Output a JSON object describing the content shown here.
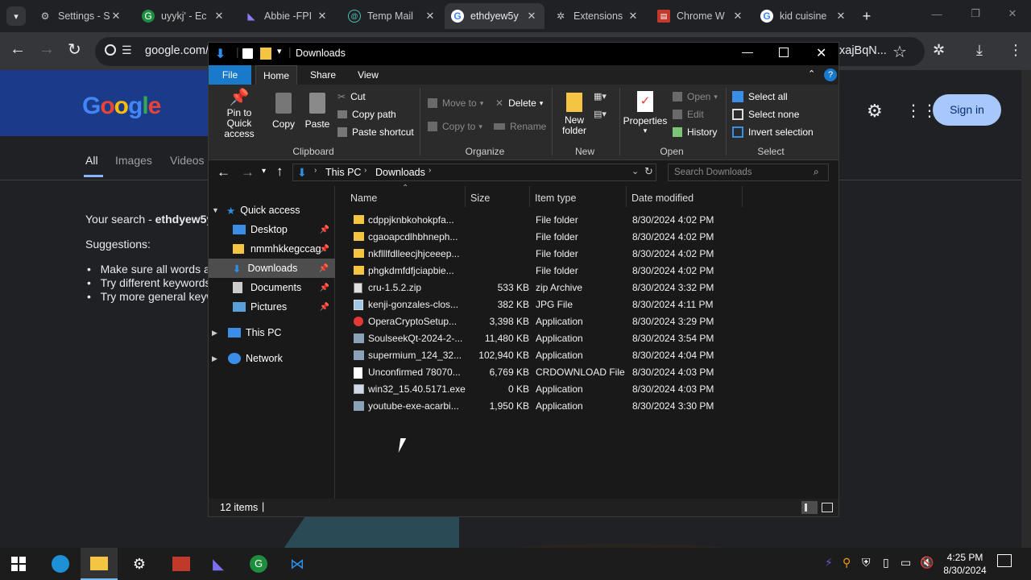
{
  "chrome": {
    "tabs": [
      {
        "title": "Settings - Se",
        "icon": "gear-icon"
      },
      {
        "title": "uyykj' - Ec",
        "icon": "green-logo-icon"
      },
      {
        "title": "Abbie -FPI",
        "icon": "proton-icon"
      },
      {
        "title": "Temp Mail",
        "icon": "tempmail-icon"
      },
      {
        "title": "ethdyew5y",
        "icon": "google-icon"
      },
      {
        "title": "Extensions",
        "icon": "puzzle-icon"
      },
      {
        "title": "Chrome W",
        "icon": "store-icon"
      },
      {
        "title": "kid cuisine",
        "icon": "google-icon"
      }
    ],
    "url": "google.com/",
    "url_right": "xajBqN..."
  },
  "google": {
    "tabs": [
      "All",
      "Images",
      "Videos"
    ],
    "search_prefix": "Your search - ",
    "search_term": "ethdyew5y",
    "suggestions_label": "Suggestions:",
    "suggestions": [
      "Make sure all words a",
      "Try different keywords",
      "Try more general keyw"
    ],
    "sign_in": "Sign in"
  },
  "explorer": {
    "title": "Downloads",
    "ribbon_tabs": [
      "File",
      "Home",
      "Share",
      "View"
    ],
    "clipboard": {
      "pin": "Pin to Quick access",
      "copy": "Copy",
      "paste": "Paste",
      "cut": "Cut",
      "copy_path": "Copy path",
      "paste_shortcut": "Paste shortcut",
      "group": "Clipboard"
    },
    "organize": {
      "move_to": "Move to",
      "copy_to": "Copy to",
      "delete": "Delete",
      "rename": "Rename",
      "group": "Organize"
    },
    "new": {
      "new_folder": "New folder",
      "group": "New"
    },
    "open": {
      "properties": "Properties",
      "open": "Open",
      "edit": "Edit",
      "history": "History",
      "group": "Open"
    },
    "select": {
      "select_all": "Select all",
      "select_none": "Select none",
      "invert": "Invert selection",
      "group": "Select"
    },
    "breadcrumb": [
      "This PC",
      "Downloads"
    ],
    "search_placeholder": "Search Downloads",
    "nav": {
      "quick_access": "Quick access",
      "items": [
        {
          "label": "Desktop",
          "pinned": true
        },
        {
          "label": "nmmhkkegccag",
          "pinned": true
        },
        {
          "label": "Downloads",
          "pinned": true
        },
        {
          "label": "Documents",
          "pinned": true
        },
        {
          "label": "Pictures",
          "pinned": true
        }
      ],
      "this_pc": "This PC",
      "network": "Network"
    },
    "columns": [
      "Name",
      "Size",
      "Item type",
      "Date modified"
    ],
    "files": [
      {
        "name": "cdppjknbkohokpfa...",
        "size": "",
        "type": "File folder",
        "date": "8/30/2024 4:02 PM",
        "icon": "folder"
      },
      {
        "name": "cgaoapcdlhbhneph...",
        "size": "",
        "type": "File folder",
        "date": "8/30/2024 4:02 PM",
        "icon": "folder"
      },
      {
        "name": "nkflllfdlleecjhjceeep...",
        "size": "",
        "type": "File folder",
        "date": "8/30/2024 4:02 PM",
        "icon": "folder"
      },
      {
        "name": "phgkdmfdfjciapbie...",
        "size": "",
        "type": "File folder",
        "date": "8/30/2024 4:02 PM",
        "icon": "folder"
      },
      {
        "name": "cru-1.5.2.zip",
        "size": "533 KB",
        "type": "zip Archive",
        "date": "8/30/2024 3:32 PM",
        "icon": "zip"
      },
      {
        "name": "kenji-gonzales-clos...",
        "size": "382 KB",
        "type": "JPG File",
        "date": "8/30/2024 4:11 PM",
        "icon": "image"
      },
      {
        "name": "OperaCryptoSetup...",
        "size": "3,398 KB",
        "type": "Application",
        "date": "8/30/2024 3:29 PM",
        "icon": "opera"
      },
      {
        "name": "SoulseekQt-2024-2-...",
        "size": "11,480 KB",
        "type": "Application",
        "date": "8/30/2024 3:54 PM",
        "icon": "app"
      },
      {
        "name": "supermium_124_32...",
        "size": "102,940 KB",
        "type": "Application",
        "date": "8/30/2024 4:04 PM",
        "icon": "app"
      },
      {
        "name": "Unconfirmed 78070...",
        "size": "6,769 KB",
        "type": "CRDOWNLOAD File",
        "date": "8/30/2024 4:03 PM",
        "icon": "blank"
      },
      {
        "name": "win32_15.40.5171.exe",
        "size": "0 KB",
        "type": "Application",
        "date": "8/30/2024 4:03 PM",
        "icon": "exe"
      },
      {
        "name": "youtube-exe-acarbi...",
        "size": "1,950 KB",
        "type": "Application",
        "date": "8/30/2024 3:30 PM",
        "icon": "app"
      }
    ],
    "status": "12 items"
  },
  "taskbar": {
    "time": "4:25 PM",
    "date": "8/30/2024"
  }
}
